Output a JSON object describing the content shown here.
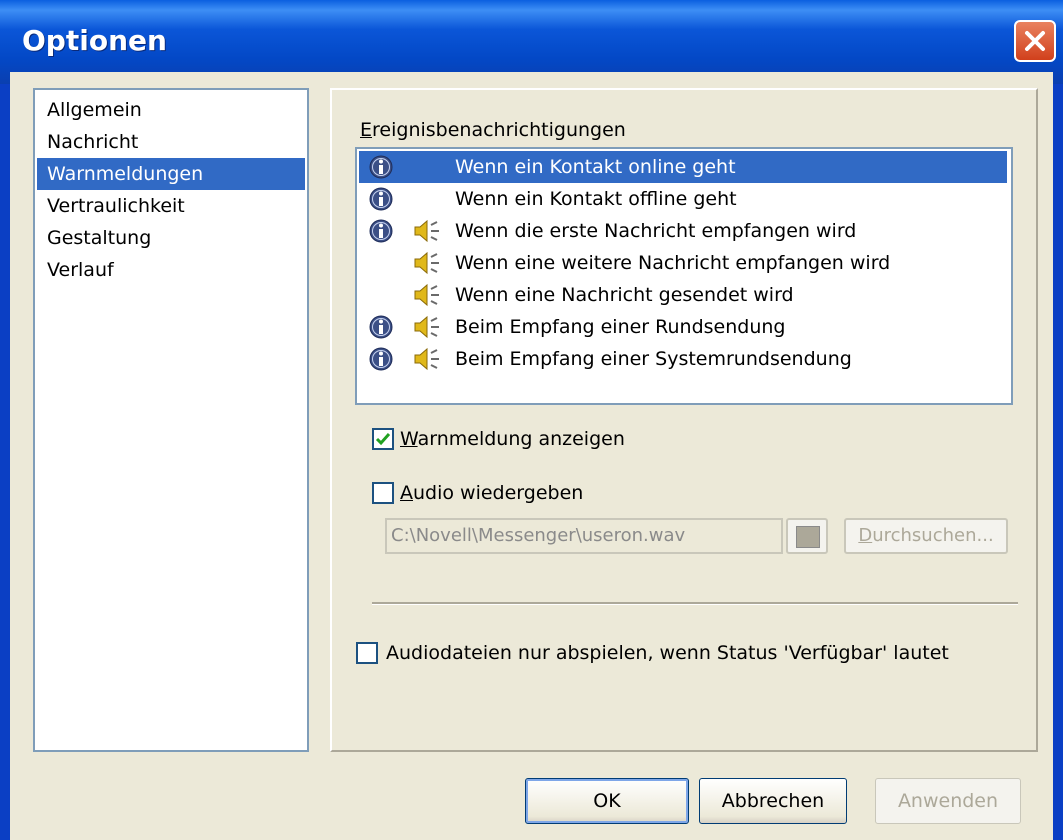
{
  "window": {
    "title": "Optionen"
  },
  "nav": {
    "items": [
      {
        "label": "Allgemein",
        "selected": false
      },
      {
        "label": "Nachricht",
        "selected": false
      },
      {
        "label": "Warnmeldungen",
        "selected": true
      },
      {
        "label": "Vertraulichkeit",
        "selected": false
      },
      {
        "label": "Gestaltung",
        "selected": false
      },
      {
        "label": "Verlauf",
        "selected": false
      }
    ]
  },
  "events": {
    "label": "Ereignisbenachrichtigungen",
    "items": [
      {
        "label": "Wenn ein Kontakt online geht",
        "info_icon": true,
        "sound_icon": false,
        "selected": true
      },
      {
        "label": "Wenn ein Kontakt offline geht",
        "info_icon": true,
        "sound_icon": false,
        "selected": false
      },
      {
        "label": "Wenn die erste Nachricht empfangen wird",
        "info_icon": true,
        "sound_icon": true,
        "selected": false
      },
      {
        "label": "Wenn eine weitere Nachricht empfangen wird",
        "info_icon": false,
        "sound_icon": true,
        "selected": false
      },
      {
        "label": "Wenn eine Nachricht gesendet wird",
        "info_icon": false,
        "sound_icon": true,
        "selected": false
      },
      {
        "label": "Beim Empfang einer Rundsendung",
        "info_icon": true,
        "sound_icon": true,
        "selected": false
      },
      {
        "label": "Beim Empfang einer Systemrundsendung",
        "info_icon": true,
        "sound_icon": true,
        "selected": false
      }
    ]
  },
  "options": {
    "show_alert_label": "Warnmeldung anzeigen",
    "show_alert_checked": true,
    "play_audio_label": "Audio wiedergeben",
    "play_audio_checked": false,
    "audio_path": "C:\\Novell\\Messenger\\useron.wav",
    "browse_label": "Durchsuchen...",
    "only_available_label": "Audiodateien nur abspielen, wenn Status 'Verfügbar' lautet",
    "only_available_checked": false
  },
  "buttons": {
    "ok": "OK",
    "cancel": "Abbrechen",
    "apply": "Anwenden"
  },
  "colors": {
    "selection": "#316ac5",
    "titlebar": "#0b56d8",
    "dialog_bg": "#ece9d8"
  }
}
